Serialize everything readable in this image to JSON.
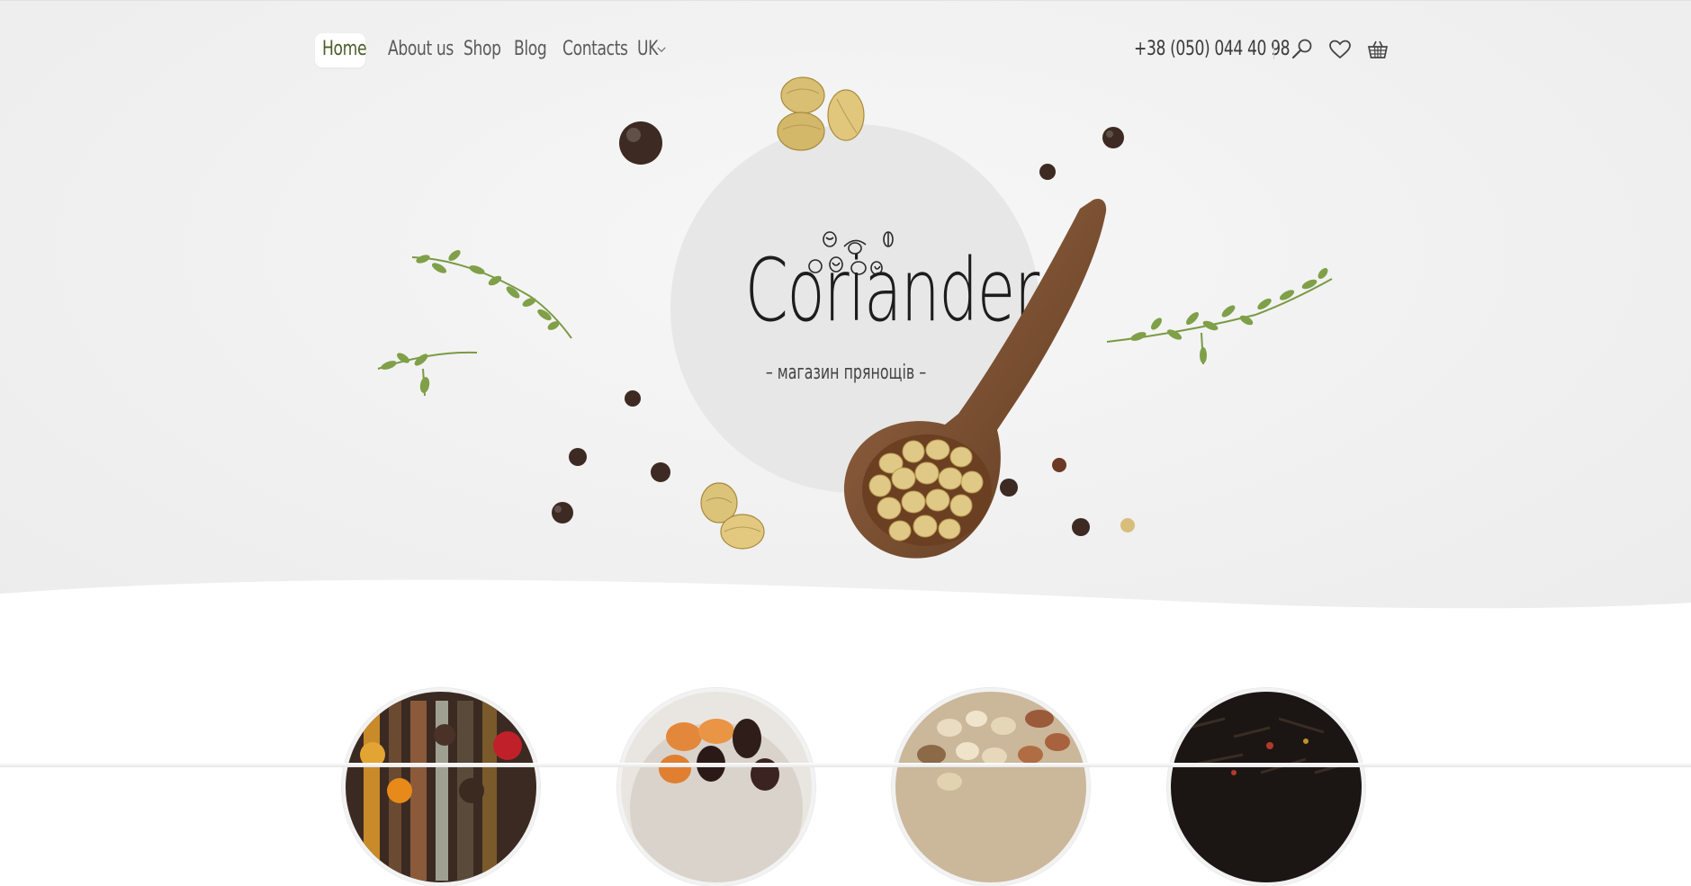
{
  "nav": {
    "items": [
      {
        "label": "Home",
        "active": true
      },
      {
        "label": "About us",
        "active": false
      },
      {
        "label": "Shop",
        "active": false
      },
      {
        "label": "Blog",
        "active": false
      },
      {
        "label": "Contacts",
        "active": false
      }
    ],
    "language": "UK",
    "phone": "+38 (050) 044 40 98",
    "icons": [
      "search-icon",
      "heart-icon",
      "basket-icon"
    ]
  },
  "hero": {
    "brand": "Coriander",
    "tagline": "– магазин прянощів –"
  },
  "categories": [
    {
      "name": "spices-category",
      "icon": "spice-spoons-image"
    },
    {
      "name": "dried-fruit-category",
      "icon": "dried-fruit-bowl-image"
    },
    {
      "name": "nuts-category",
      "icon": "nuts-image"
    },
    {
      "name": "tea-category",
      "icon": "tea-leaves-image"
    }
  ],
  "colors": {
    "accent": "#4b5e2a",
    "text": "#5a5a5a",
    "hero_bg": "#f0f0f0",
    "logo_circle": "#e7e7e7",
    "wood": "#7a4a2b",
    "seed": "#d9c07a",
    "thyme": "#7a9a45"
  }
}
